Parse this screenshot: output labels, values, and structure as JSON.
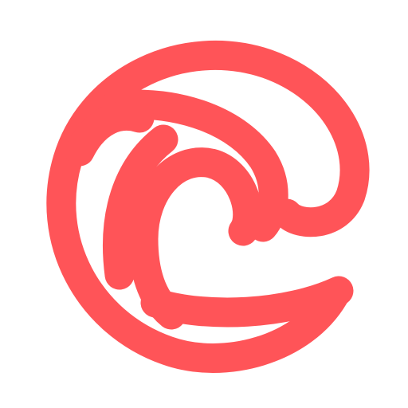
{
  "logo": {
    "icon": "swirl-wave-logo-icon",
    "color": "#FF5458",
    "background": "#FFFFFF"
  }
}
